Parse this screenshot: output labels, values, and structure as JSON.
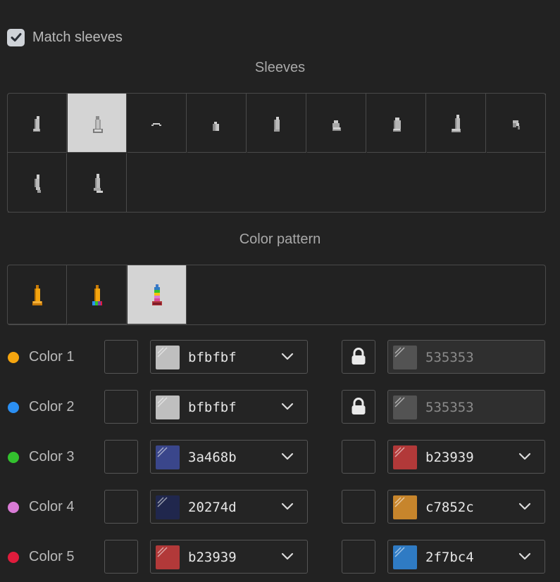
{
  "match_sleeves": {
    "label": "Match sleeves",
    "checked": true
  },
  "sleeves_section": {
    "title": "Sleeves",
    "selected_index": 1,
    "items": [
      {
        "icon": "sleeve-style-1-icon"
      },
      {
        "icon": "sleeve-style-2-icon"
      },
      {
        "icon": "sleeve-style-3-icon"
      },
      {
        "icon": "sleeve-style-4-icon"
      },
      {
        "icon": "sleeve-style-5-icon"
      },
      {
        "icon": "sleeve-style-6-icon"
      },
      {
        "icon": "sleeve-style-7-icon"
      },
      {
        "icon": "sleeve-style-8-icon"
      },
      {
        "icon": "sleeve-style-9-icon"
      },
      {
        "icon": "sleeve-style-10-icon"
      },
      {
        "icon": "sleeve-style-11-icon"
      }
    ]
  },
  "pattern_section": {
    "title": "Color pattern",
    "selected_index": 2,
    "items": [
      {
        "icon": "pattern-solid-icon"
      },
      {
        "icon": "pattern-trim-icon"
      },
      {
        "icon": "pattern-rainbow-icon"
      }
    ]
  },
  "colors": [
    {
      "label": "Color 1",
      "dot": "#f5a50f",
      "primary": {
        "hex": "bfbfbf",
        "color": "#bfbfbf"
      },
      "locked": true,
      "secondary": {
        "hex": "535353",
        "color": "#535353"
      }
    },
    {
      "label": "Color 2",
      "dot": "#2b8ff2",
      "primary": {
        "hex": "bfbfbf",
        "color": "#bfbfbf"
      },
      "locked": true,
      "secondary": {
        "hex": "535353",
        "color": "#535353"
      }
    },
    {
      "label": "Color 3",
      "dot": "#33c12e",
      "primary": {
        "hex": "3a468b",
        "color": "#3a468b"
      },
      "locked": false,
      "secondary": {
        "hex": "b23939",
        "color": "#b23939"
      }
    },
    {
      "label": "Color 4",
      "dot": "#d97bd6",
      "primary": {
        "hex": "20274d",
        "color": "#20274d"
      },
      "locked": false,
      "secondary": {
        "hex": "c7852c",
        "color": "#c7852c"
      }
    },
    {
      "label": "Color 5",
      "dot": "#e01c3c",
      "primary": {
        "hex": "b23939",
        "color": "#b23939"
      },
      "locked": false,
      "secondary": {
        "hex": "2f7bc4",
        "color": "#2f7bc4"
      }
    }
  ]
}
